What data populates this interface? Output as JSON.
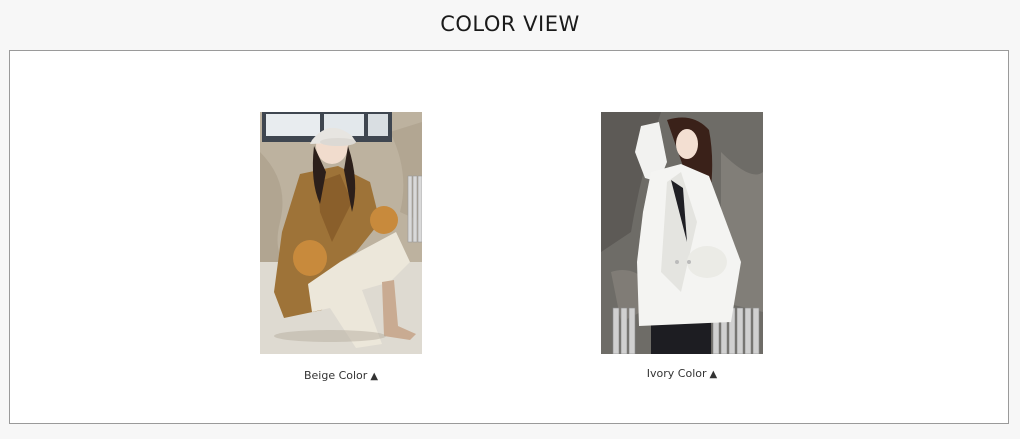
{
  "header": {
    "title": "COLOR VIEW"
  },
  "colors": [
    {
      "label": "Beige Color",
      "icon": "triangle-up-icon"
    },
    {
      "label": "Ivory Color",
      "icon": "triangle-up-icon"
    }
  ]
}
